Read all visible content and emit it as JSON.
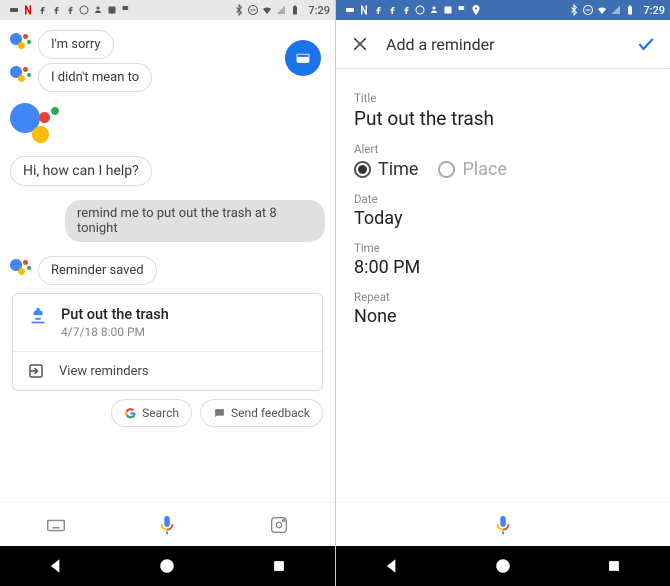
{
  "status_time": "7:29",
  "left": {
    "messages": {
      "sorry": "I'm sorry",
      "didnt_mean": "I didn't mean to",
      "greeting": "Hi, how can I help?",
      "user_request": "remind me to put out the trash at 8 tonight",
      "saved": "Reminder saved"
    },
    "reminder_card": {
      "title": "Put out the trash",
      "datetime": "4/7/18 8:00 PM",
      "view_label": "View reminders"
    },
    "chips": {
      "search": "Search",
      "feedback": "Send feedback"
    }
  },
  "right": {
    "header_title": "Add a reminder",
    "title_label": "Title",
    "title_value": "Put out the trash",
    "alert_label": "Alert",
    "alert_time": "Time",
    "alert_place": "Place",
    "date_label": "Date",
    "date_value": "Today",
    "time_label": "Time",
    "time_value": "8:00 PM",
    "repeat_label": "Repeat",
    "repeat_value": "None"
  }
}
